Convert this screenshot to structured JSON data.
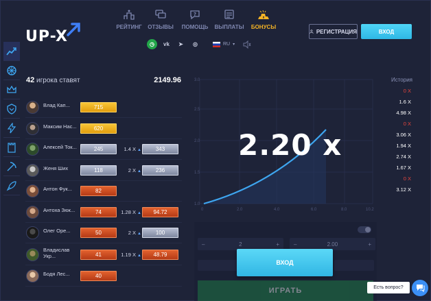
{
  "header": {
    "logo": "UP-X",
    "nav": [
      {
        "label": "РЕЙТИНГ",
        "icon": "podium-icon",
        "active": false
      },
      {
        "label": "ОТЗЫВЫ",
        "icon": "reviews-icon",
        "active": false
      },
      {
        "label": "ПОМОЩЬ",
        "icon": "help-icon",
        "active": false
      },
      {
        "label": "ВЫПЛАТЫ",
        "icon": "payouts-icon",
        "active": false
      },
      {
        "label": "БОНУСЫ",
        "icon": "gold-bars-icon",
        "active": true
      }
    ],
    "social": [
      {
        "name": "timer-icon",
        "glyph": "◷"
      },
      {
        "name": "vk-icon",
        "glyph": "vk"
      },
      {
        "name": "telegram-icon",
        "glyph": "➤"
      },
      {
        "name": "instagram-icon",
        "glyph": "◎"
      }
    ],
    "language": "RU",
    "register_label": "РЕГИСТРАЦИЯ",
    "login_label": "ВХОД"
  },
  "sidebar": [
    {
      "name": "sidebar-item-crash",
      "active": true
    },
    {
      "name": "sidebar-item-wheel",
      "active": false
    },
    {
      "name": "sidebar-item-crown",
      "active": false
    },
    {
      "name": "sidebar-item-shield",
      "active": false
    },
    {
      "name": "sidebar-item-lightning",
      "active": false
    },
    {
      "name": "sidebar-item-tower",
      "active": false
    },
    {
      "name": "sidebar-item-mines",
      "active": false
    },
    {
      "name": "sidebar-item-rocket",
      "active": false
    }
  ],
  "bets": {
    "count": "42",
    "count_label": "игрока ставят",
    "total": "2149.96",
    "rows": [
      {
        "name": "Влад Кап...",
        "bet": "715",
        "bet_style": "gold",
        "mult": "",
        "win": "",
        "win_style": ""
      },
      {
        "name": "Максим Нас...",
        "bet": "620",
        "bet_style": "gold",
        "mult": "",
        "win": "",
        "win_style": ""
      },
      {
        "name": "Алексей Ток...",
        "bet": "245",
        "bet_style": "silver",
        "mult": "1.4 X",
        "win": "343",
        "win_style": "silver"
      },
      {
        "name": "Женя Ших",
        "bet": "118",
        "bet_style": "silver",
        "mult": "2 X",
        "win": "236",
        "win_style": "silver"
      },
      {
        "name": "Антон Фук...",
        "bet": "82",
        "bet_style": "red",
        "mult": "",
        "win": "",
        "win_style": ""
      },
      {
        "name": "Антоха Зюк...",
        "bet": "74",
        "bet_style": "red",
        "mult": "1.28 X",
        "win": "94.72",
        "win_style": "red"
      },
      {
        "name": "Олег Оре...",
        "bet": "50",
        "bet_style": "red",
        "mult": "2 X",
        "win": "100",
        "win_style": "silver"
      },
      {
        "name": "Владислав Укр...",
        "bet": "41",
        "bet_style": "red",
        "mult": "1.19 X",
        "win": "48.79",
        "win_style": "red"
      },
      {
        "name": "Бодя Лес...",
        "bet": "40",
        "bet_style": "red",
        "mult": "",
        "win": "",
        "win_style": ""
      }
    ]
  },
  "graph": {
    "multiplier": "2.20 x",
    "y_ticks": [
      "3.0",
      "2.5",
      "2.0",
      "1.5",
      "1.0"
    ],
    "x_ticks": [
      "0",
      "2.0",
      "4.0",
      "6.0",
      "8.0",
      "10.2"
    ]
  },
  "history": {
    "title": "История",
    "items": [
      "0 X",
      "1.6 X",
      "4.98 X",
      "0 X",
      "3.06 X",
      "1.94 X",
      "2.74 X",
      "1.67 X",
      "0 X",
      "3.12 X"
    ]
  },
  "bet_panel": {
    "amount": "2",
    "auto_cashout": "2.00",
    "play_label": "ИГРАТЬ"
  },
  "modal": {
    "login_label": "ВХОД"
  },
  "chat": {
    "label": "Есть вопрос?"
  },
  "colors": {
    "background": "#1e2338",
    "accent": "#f4b325",
    "login": "#31b6e4",
    "zero": "#e5453d",
    "curve": "#3ea6f0"
  }
}
